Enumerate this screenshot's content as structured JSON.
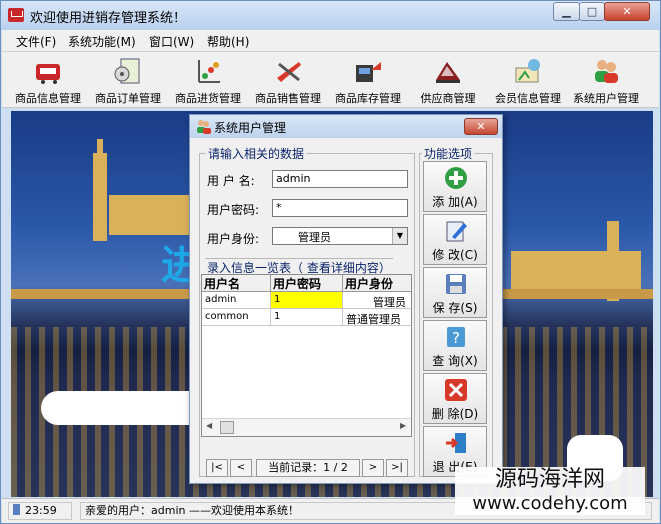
{
  "window": {
    "title": "欢迎使用进销存管理系统！"
  },
  "menu": [
    "文件(F)",
    "系统功能(M)",
    "窗口(W)",
    "帮助(H)"
  ],
  "toolbar": [
    {
      "label": "商品信息管理",
      "icon": "product-info-icon"
    },
    {
      "label": "商品订单管理",
      "icon": "order-icon"
    },
    {
      "label": "商品进货管理",
      "icon": "purchase-icon"
    },
    {
      "label": "商品销售管理",
      "icon": "sales-icon"
    },
    {
      "label": "商品库存管理",
      "icon": "inventory-icon"
    },
    {
      "label": "供应商管理",
      "icon": "supplier-icon"
    },
    {
      "label": "会员信息管理",
      "icon": "member-icon"
    },
    {
      "label": "系统用户管理",
      "icon": "users-icon"
    }
  ],
  "scene": {
    "overlay_char": "进"
  },
  "dialog": {
    "title": "系统用户管理",
    "input_group": "请输入相关的数据",
    "options_group": "功能选项",
    "fields": {
      "username_label": "用 户 名:",
      "username_value": "admin",
      "password_label": "用户密码:",
      "password_value": "*",
      "role_label": "用户身份:",
      "role_value": "管理员"
    },
    "list_group": "录入信息一览表（    查看详细内容）",
    "columns": [
      "用户名",
      "用户密码",
      "用户身份"
    ],
    "rows": [
      [
        "admin",
        "1",
        "管理员"
      ],
      [
        "common",
        "1",
        "普通管理员"
      ]
    ],
    "nav": {
      "first": "|<",
      "prev": "<",
      "record": "当前记录：1 / 2",
      "next": ">",
      "last": ">|"
    },
    "actions": [
      {
        "label": "添 加(A)",
        "color": "#2ea043"
      },
      {
        "label": "修 改(C)",
        "color": "#2f6fd6"
      },
      {
        "label": "保 存(S)",
        "color": "#5a7fbf"
      },
      {
        "label": "查 询(X)",
        "color": "#4a9ad8"
      },
      {
        "label": "删 除(D)",
        "color": "#d83a2a"
      },
      {
        "label": "退 出(E)",
        "color": "#2f7fc8"
      }
    ]
  },
  "status": {
    "time": "23:59",
    "message": "亲爱的用户：admin ——欢迎使用本系统！"
  },
  "watermark": {
    "line1": "源码海洋网",
    "line2": "www.codehy.com"
  }
}
